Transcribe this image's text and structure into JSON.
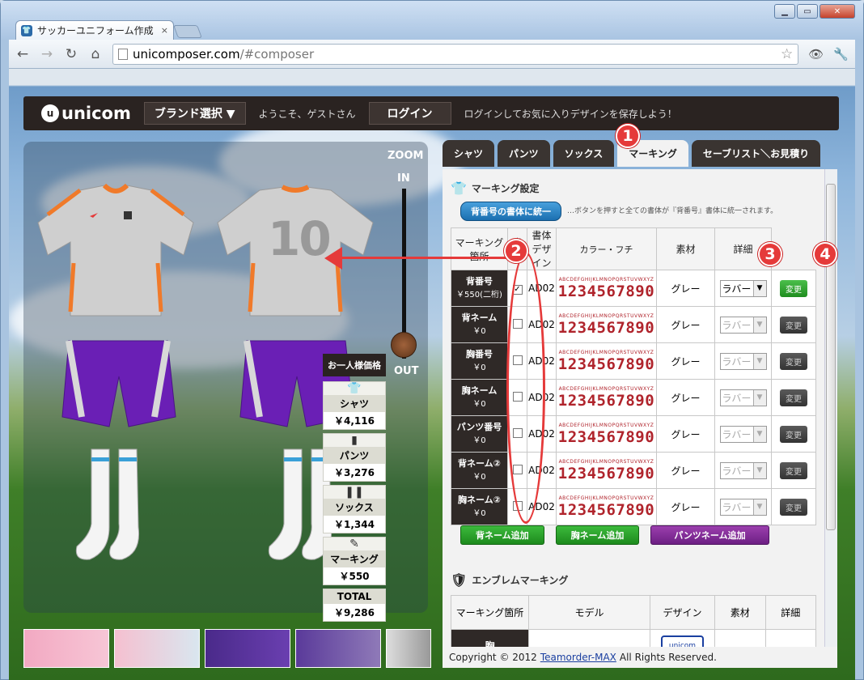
{
  "browser": {
    "tab_title": "サッカーユニフォーム作成",
    "tab_close": "×",
    "url_host": "unicomposer.com",
    "url_path": "/#composer",
    "nav": {
      "back": "←",
      "forward": "→",
      "reload": "↻",
      "home": "⌂"
    }
  },
  "site": {
    "logo_text": "unicom",
    "logo_mark": "u",
    "brand_select": "ブランド選択 ▼",
    "welcome": "ようこそ、ゲストさん",
    "login": "ログイン",
    "login_message": "ログインしてお気に入りデザインを保存しよう！"
  },
  "preview": {
    "zoom": "ZOOM",
    "zoom_in": "IN",
    "zoom_out": "OUT",
    "zoom_level": 0.92,
    "back_number": "10",
    "price_header": "お一人様価格",
    "prices": [
      {
        "label": "シャツ",
        "value": "￥4,116",
        "icon": "shirt-icon"
      },
      {
        "label": "パンツ",
        "value": "￥3,276",
        "icon": "pants-icon"
      },
      {
        "label": "ソックス",
        "value": "￥1,344",
        "icon": "socks-icon"
      },
      {
        "label": "マーキング",
        "value": "￥550",
        "icon": "marking-icon"
      },
      {
        "label": "TOTAL",
        "value": "￥9,286",
        "icon": ""
      }
    ]
  },
  "tabs": [
    {
      "label": "シャツ"
    },
    {
      "label": "パンツ"
    },
    {
      "label": "ソックス"
    },
    {
      "label": "マーキング"
    },
    {
      "label": "セーブリスト＼お見積り"
    }
  ],
  "marking": {
    "section_title": "マーキング設定",
    "unify_button": "背番号の書体に統一",
    "unify_note": "…ボタンを押すと全ての書体が『背番号』書体に統一されます。",
    "headers": [
      "マーキング箇所",
      "書体",
      "書体デザイン",
      "カラー・フチ",
      "素材",
      "詳細"
    ],
    "font_alpha": "ABCDEFGHIJKLMNOPQRSTUVWXYZ",
    "font_digits": "1234567890",
    "rows": [
      {
        "name": "背番号",
        "price": "￥550(二桁)",
        "checked": true,
        "checkmark": "✓",
        "font": "AD02",
        "color": "グレー",
        "material": "ラバー",
        "detail": "変更"
      },
      {
        "name": "背ネーム",
        "price": "￥0",
        "checked": false,
        "checkmark": "",
        "font": "AD02",
        "color": "グレー",
        "material": "ラバー",
        "detail": "変更"
      },
      {
        "name": "胸番号",
        "price": "￥0",
        "checked": false,
        "checkmark": "",
        "font": "AD02",
        "color": "グレー",
        "material": "ラバー",
        "detail": "変更"
      },
      {
        "name": "胸ネーム",
        "price": "￥0",
        "checked": false,
        "checkmark": "",
        "font": "AD02",
        "color": "グレー",
        "material": "ラバー",
        "detail": "変更"
      },
      {
        "name": "パンツ番号",
        "price": "￥0",
        "checked": false,
        "checkmark": "",
        "font": "AD02",
        "color": "グレー",
        "material": "ラバー",
        "detail": "変更"
      },
      {
        "name": "背ネーム②",
        "price": "￥0",
        "checked": false,
        "checkmark": "",
        "font": "AD02",
        "color": "グレー",
        "material": "ラバー",
        "detail": "変更"
      },
      {
        "name": "胸ネーム②",
        "price": "￥0",
        "checked": false,
        "checkmark": "",
        "font": "AD02",
        "color": "グレー",
        "material": "ラバー",
        "detail": "変更"
      }
    ],
    "add_buttons": [
      "背ネーム追加",
      "胸ネーム追加",
      "パンツネーム追加"
    ]
  },
  "emblem": {
    "section_title": "エンブレムマーキング",
    "headers": [
      "マーキング箇所",
      "モデル",
      "デザイン",
      "素材",
      "詳細"
    ],
    "first_row_label": "胸",
    "design_label": "unicom"
  },
  "annotations": {
    "badge1": "1",
    "badge2": "2",
    "badge3": "3",
    "badge4": "4"
  },
  "footer": {
    "copyright": "Copyright © 2012",
    "company": "Teamorder-MAX",
    "rights": "All Rights Reserved."
  },
  "colors": {
    "accent_red": "#e53a3a",
    "header_dark": "#2a2321",
    "font_red": "#b0242c",
    "pants_purple": "#6a1fb5",
    "shirt_orange": "#f07a2a"
  }
}
